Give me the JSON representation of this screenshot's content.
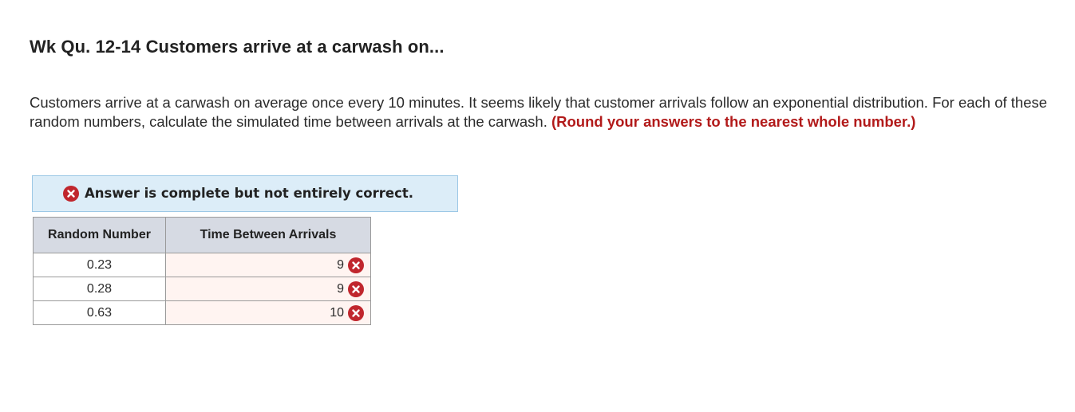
{
  "header": {
    "title": "Wk Qu. 12-14 Customers arrive at a carwash on..."
  },
  "question": {
    "text": "Customers arrive at a carwash on average once every 10 minutes. It seems likely that customer arrivals follow an exponential distribution. For each of these random numbers, calculate the simulated time between arrivals at the carwash.",
    "instruction": "(Round your answers to the nearest whole number.)"
  },
  "feedback": {
    "message": "Answer is complete but not entirely correct.",
    "icon": "x-circle-icon",
    "status_color": "#c0262d",
    "banner_color": "#dcedf8"
  },
  "table": {
    "headers": {
      "random_number": "Random Number",
      "time_between": "Time Between Arrivals"
    },
    "rows": [
      {
        "random": "0.23",
        "time": "9",
        "status": "incorrect"
      },
      {
        "random": "0.28",
        "time": "9",
        "status": "incorrect"
      },
      {
        "random": "0.63",
        "time": "10",
        "status": "incorrect"
      }
    ]
  }
}
